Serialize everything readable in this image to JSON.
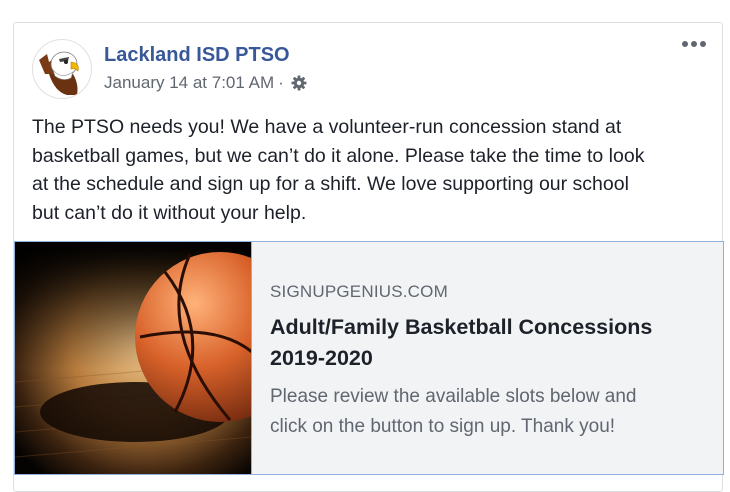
{
  "post": {
    "page_name": "Lackland ISD PTSO",
    "timestamp": "January 14 at 7:01 AM",
    "separator": "·",
    "audience_icon": "gear-icon",
    "more_icon": "ellipsis-icon",
    "avatar_icon": "eagle-mascot-logo",
    "text": [
      "The PTSO needs you! We have a volunteer-run concession stand at",
      "basketball games, but we can’t do it alone. Please take the time to look",
      "at the schedule and sign up for a shift. We love supporting our school",
      "but can’t do it without your help."
    ]
  },
  "link_preview": {
    "domain": "SIGNUPGENIUS.COM",
    "title_lines": [
      "Adult/Family Basketball Concessions",
      "2019-2020"
    ],
    "description_lines": [
      "Please review the available slots below and",
      "click on the button to sign up. Thank you!"
    ],
    "image_icon": "basketball-image"
  },
  "colors": {
    "page_name": "#385898",
    "card_border": "#90b0dc",
    "card_background": "#f2f3f5"
  }
}
